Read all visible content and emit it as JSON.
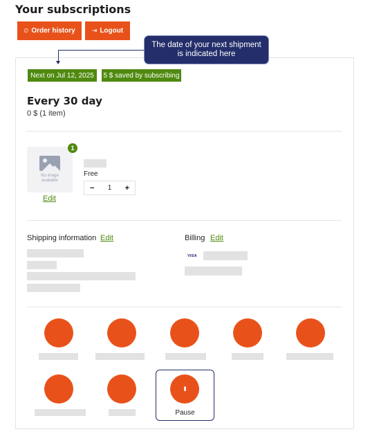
{
  "page": {
    "title": "Your subscriptions"
  },
  "header": {
    "order_history_icon": "clock-icon",
    "order_history_label": "Order history",
    "logout_icon": "logout-icon",
    "logout_label": "Logout"
  },
  "tooltip": {
    "text": "The date of your next shipment is indicated here"
  },
  "subscription": {
    "next_badge": "Next on Jul 12, 2025",
    "saved_badge": "5 $ saved by subscribing",
    "frequency": "Every 30 day",
    "total": "0 $ (1 item)"
  },
  "product": {
    "image_placeholder": "No image available",
    "quantity_badge": "1",
    "edit_label": "Edit",
    "price": "Free",
    "stepper": {
      "decrement": "−",
      "value": "1",
      "increment": "+"
    }
  },
  "shipping": {
    "label": "Shipping information",
    "edit_label": "Edit"
  },
  "billing": {
    "label": "Billing",
    "edit_label": "Edit",
    "card_brand": "VISA"
  },
  "actions": {
    "pause_icon": "pause-icon",
    "pause_glyph": "II",
    "pause_label": "Pause"
  },
  "colors": {
    "accent": "#e8521a",
    "success": "#4f8a10",
    "navy": "#232e6a",
    "placeholder": "#e2e2e2"
  }
}
